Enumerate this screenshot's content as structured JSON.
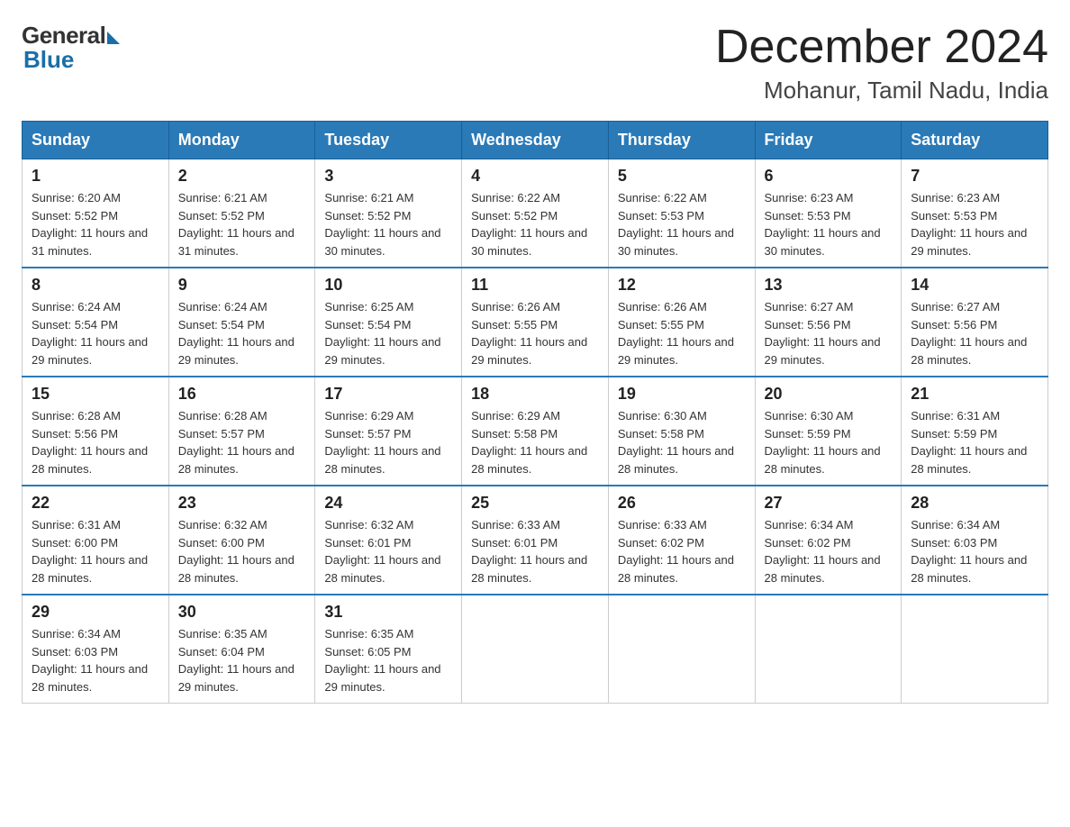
{
  "header": {
    "logo_general": "General",
    "logo_blue": "Blue",
    "month_title": "December 2024",
    "location": "Mohanur, Tamil Nadu, India"
  },
  "weekdays": [
    "Sunday",
    "Monday",
    "Tuesday",
    "Wednesday",
    "Thursday",
    "Friday",
    "Saturday"
  ],
  "weeks": [
    [
      {
        "day": "1",
        "sunrise": "6:20 AM",
        "sunset": "5:52 PM",
        "daylight": "11 hours and 31 minutes."
      },
      {
        "day": "2",
        "sunrise": "6:21 AM",
        "sunset": "5:52 PM",
        "daylight": "11 hours and 31 minutes."
      },
      {
        "day": "3",
        "sunrise": "6:21 AM",
        "sunset": "5:52 PM",
        "daylight": "11 hours and 30 minutes."
      },
      {
        "day": "4",
        "sunrise": "6:22 AM",
        "sunset": "5:52 PM",
        "daylight": "11 hours and 30 minutes."
      },
      {
        "day": "5",
        "sunrise": "6:22 AM",
        "sunset": "5:53 PM",
        "daylight": "11 hours and 30 minutes."
      },
      {
        "day": "6",
        "sunrise": "6:23 AM",
        "sunset": "5:53 PM",
        "daylight": "11 hours and 30 minutes."
      },
      {
        "day": "7",
        "sunrise": "6:23 AM",
        "sunset": "5:53 PM",
        "daylight": "11 hours and 29 minutes."
      }
    ],
    [
      {
        "day": "8",
        "sunrise": "6:24 AM",
        "sunset": "5:54 PM",
        "daylight": "11 hours and 29 minutes."
      },
      {
        "day": "9",
        "sunrise": "6:24 AM",
        "sunset": "5:54 PM",
        "daylight": "11 hours and 29 minutes."
      },
      {
        "day": "10",
        "sunrise": "6:25 AM",
        "sunset": "5:54 PM",
        "daylight": "11 hours and 29 minutes."
      },
      {
        "day": "11",
        "sunrise": "6:26 AM",
        "sunset": "5:55 PM",
        "daylight": "11 hours and 29 minutes."
      },
      {
        "day": "12",
        "sunrise": "6:26 AM",
        "sunset": "5:55 PM",
        "daylight": "11 hours and 29 minutes."
      },
      {
        "day": "13",
        "sunrise": "6:27 AM",
        "sunset": "5:56 PM",
        "daylight": "11 hours and 29 minutes."
      },
      {
        "day": "14",
        "sunrise": "6:27 AM",
        "sunset": "5:56 PM",
        "daylight": "11 hours and 28 minutes."
      }
    ],
    [
      {
        "day": "15",
        "sunrise": "6:28 AM",
        "sunset": "5:56 PM",
        "daylight": "11 hours and 28 minutes."
      },
      {
        "day": "16",
        "sunrise": "6:28 AM",
        "sunset": "5:57 PM",
        "daylight": "11 hours and 28 minutes."
      },
      {
        "day": "17",
        "sunrise": "6:29 AM",
        "sunset": "5:57 PM",
        "daylight": "11 hours and 28 minutes."
      },
      {
        "day": "18",
        "sunrise": "6:29 AM",
        "sunset": "5:58 PM",
        "daylight": "11 hours and 28 minutes."
      },
      {
        "day": "19",
        "sunrise": "6:30 AM",
        "sunset": "5:58 PM",
        "daylight": "11 hours and 28 minutes."
      },
      {
        "day": "20",
        "sunrise": "6:30 AM",
        "sunset": "5:59 PM",
        "daylight": "11 hours and 28 minutes."
      },
      {
        "day": "21",
        "sunrise": "6:31 AM",
        "sunset": "5:59 PM",
        "daylight": "11 hours and 28 minutes."
      }
    ],
    [
      {
        "day": "22",
        "sunrise": "6:31 AM",
        "sunset": "6:00 PM",
        "daylight": "11 hours and 28 minutes."
      },
      {
        "day": "23",
        "sunrise": "6:32 AM",
        "sunset": "6:00 PM",
        "daylight": "11 hours and 28 minutes."
      },
      {
        "day": "24",
        "sunrise": "6:32 AM",
        "sunset": "6:01 PM",
        "daylight": "11 hours and 28 minutes."
      },
      {
        "day": "25",
        "sunrise": "6:33 AM",
        "sunset": "6:01 PM",
        "daylight": "11 hours and 28 minutes."
      },
      {
        "day": "26",
        "sunrise": "6:33 AM",
        "sunset": "6:02 PM",
        "daylight": "11 hours and 28 minutes."
      },
      {
        "day": "27",
        "sunrise": "6:34 AM",
        "sunset": "6:02 PM",
        "daylight": "11 hours and 28 minutes."
      },
      {
        "day": "28",
        "sunrise": "6:34 AM",
        "sunset": "6:03 PM",
        "daylight": "11 hours and 28 minutes."
      }
    ],
    [
      {
        "day": "29",
        "sunrise": "6:34 AM",
        "sunset": "6:03 PM",
        "daylight": "11 hours and 28 minutes."
      },
      {
        "day": "30",
        "sunrise": "6:35 AM",
        "sunset": "6:04 PM",
        "daylight": "11 hours and 29 minutes."
      },
      {
        "day": "31",
        "sunrise": "6:35 AM",
        "sunset": "6:05 PM",
        "daylight": "11 hours and 29 minutes."
      },
      null,
      null,
      null,
      null
    ]
  ]
}
